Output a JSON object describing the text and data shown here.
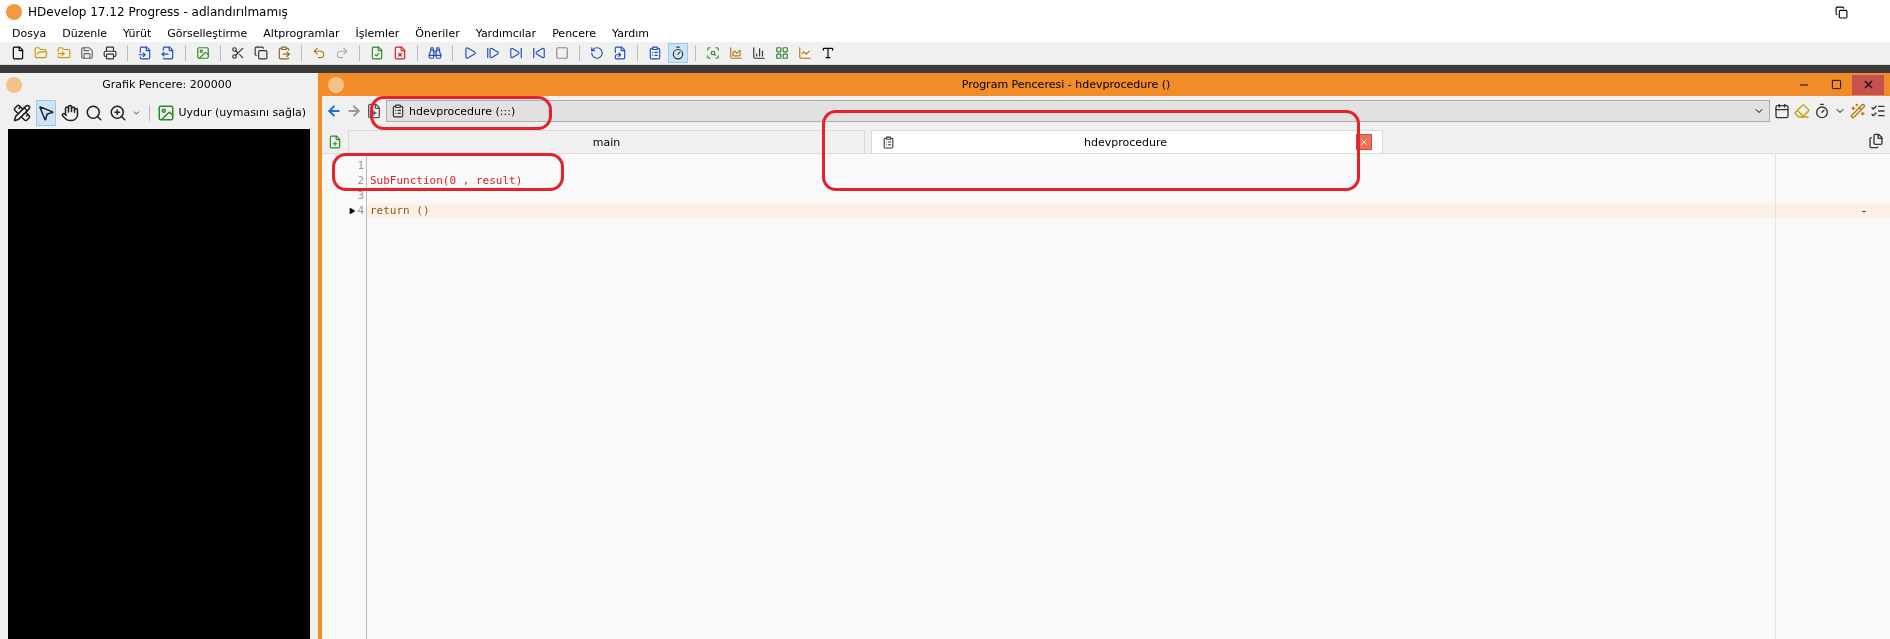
{
  "app": {
    "title": "HDevelop 17.12 Progress - adlandırılmamış"
  },
  "menu": [
    "Dosya",
    "Düzenle",
    "Yürüt",
    "Görselleştirme",
    "Altprogramlar",
    "İşlemler",
    "Öneriler",
    "Yardımcılar",
    "Pencere",
    "Yardım"
  ],
  "toolbar": {
    "timer_active": true
  },
  "graphics_window": {
    "title": "Grafik Pencere: 200000",
    "tools": [
      {
        "selected": false
      },
      {
        "selected": true
      },
      {
        "selected": false
      },
      {
        "selected": false
      },
      {
        "selected": false
      }
    ],
    "fit_button": {
      "label": "Uydur (uymasını sağla)"
    }
  },
  "program_window": {
    "title": "Program Penceresi - hdevprocedure ()",
    "procedure_field": {
      "value": "hdevprocedure (:::)"
    },
    "tabs": [
      {
        "label": "main",
        "selected": false,
        "closable": false
      },
      {
        "label": "hdevprocedure",
        "selected": true,
        "closable": true
      }
    ],
    "lines": [
      {
        "number": "1"
      },
      {
        "number": "2",
        "kind": "call",
        "text": "SubFunction(0 , result)",
        "current": false
      },
      {
        "number": "3"
      },
      {
        "number": "4",
        "kind": "return",
        "text": "return ()",
        "current": true,
        "margin_mark": "-"
      }
    ]
  }
}
